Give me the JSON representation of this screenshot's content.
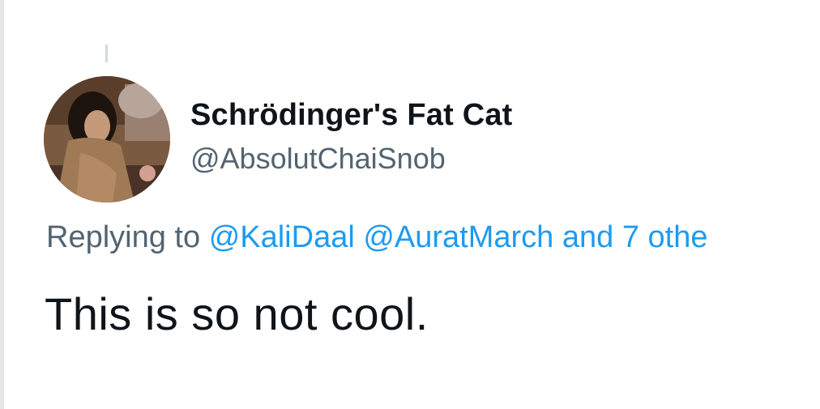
{
  "tweet": {
    "display_name": "Schrödinger's Fat Cat",
    "handle": "@AbsolutChaiSnob",
    "reply_prefix": "Replying to",
    "reply_mentions": [
      "@KaliDaal",
      "@AuratMarch"
    ],
    "reply_others": "and 7 othe",
    "text": "This is so not cool."
  },
  "colors": {
    "text_primary": "#0f1419",
    "text_secondary": "#536471",
    "link": "#1d9bf0",
    "thread_line": "#cfd9de"
  }
}
